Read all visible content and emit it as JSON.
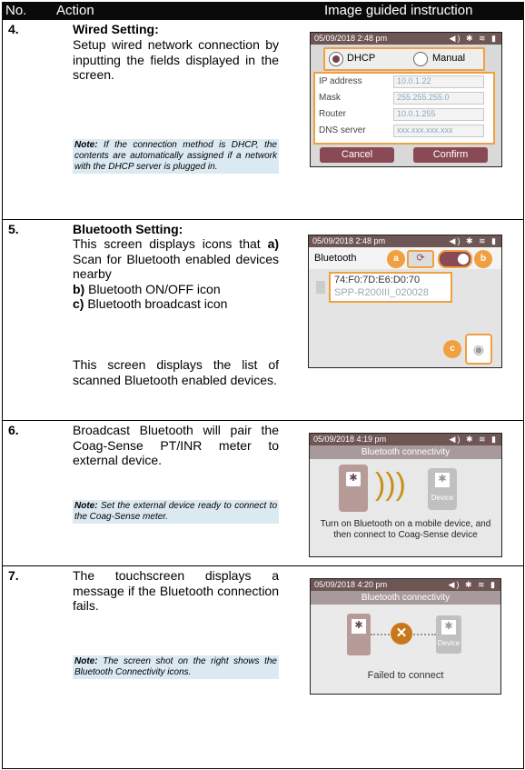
{
  "header": {
    "col_no": "No.",
    "col_action": "Action",
    "col_image": "Image guided instruction"
  },
  "rows": [
    {
      "number": "4.",
      "title": "Wired Setting:",
      "body": "Setup wired network connection by inputting the fields displayed in the screen.",
      "note_label": "Note:",
      "note": "If the connection method is DHCP, the contents are automatically assigned if a network with the DHCP server is plugged in.",
      "screen": {
        "status": "05/09/2018 2:48 pm",
        "status_icons": "◀) ✱ ≋ ▮",
        "dhcp": "DHCP",
        "manual": "Manual",
        "fields": [
          {
            "label": "IP address",
            "value": "10.0.1.22"
          },
          {
            "label": "Mask",
            "value": "255.255.255.0"
          },
          {
            "label": "Router",
            "value": "10.0.1.255"
          },
          {
            "label": "DNS server",
            "value": "xxx.xxx.xxx.xxx"
          }
        ],
        "cancel": "Cancel",
        "confirm": "Confirm"
      }
    },
    {
      "number": "5.",
      "title": "Bluetooth Setting:",
      "intro": "This screen displays icons that",
      "items": [
        {
          "key": "a)",
          "text": "Scan for Bluetooth enabled devices nearby"
        },
        {
          "key": "b)",
          "text": "Bluetooth ON/OFF icon"
        },
        {
          "key": "c)",
          "text": "Bluetooth broadcast icon"
        }
      ],
      "body2": "This screen displays the list of scanned Bluetooth enabled devices.",
      "screen": {
        "status": "05/09/2018 2:48 pm",
        "bt_label": "Bluetooth",
        "mac": "74:F0:7D:E6:D0:70",
        "device": "SPP-R200III_020028",
        "callouts": [
          "a",
          "b",
          "c"
        ]
      }
    },
    {
      "number": "6.",
      "body": "Broadcast Bluetooth will pair the Coag-Sense PT/INR meter to external device.",
      "note_label": "Note:",
      "note": "Set the external device ready to connect to the Coag-Sense meter.",
      "screen": {
        "status": "05/09/2018 4:19 pm",
        "banner": "Bluetooth connectivity",
        "device_label": "Device",
        "message": "Turn on Bluetooth on a mobile device, and then connect to Coag-Sense device"
      }
    },
    {
      "number": "7.",
      "body": "The touchscreen displays a message if the Bluetooth connection fails.",
      "note_label": "Note:",
      "note": "The screen shot on the right shows the Bluetooth Connectivity icons.",
      "screen": {
        "status": "05/09/2018 4:20 pm",
        "banner": "Bluetooth connectivity",
        "device_label": "Device",
        "message": "Failed to connect"
      }
    }
  ]
}
